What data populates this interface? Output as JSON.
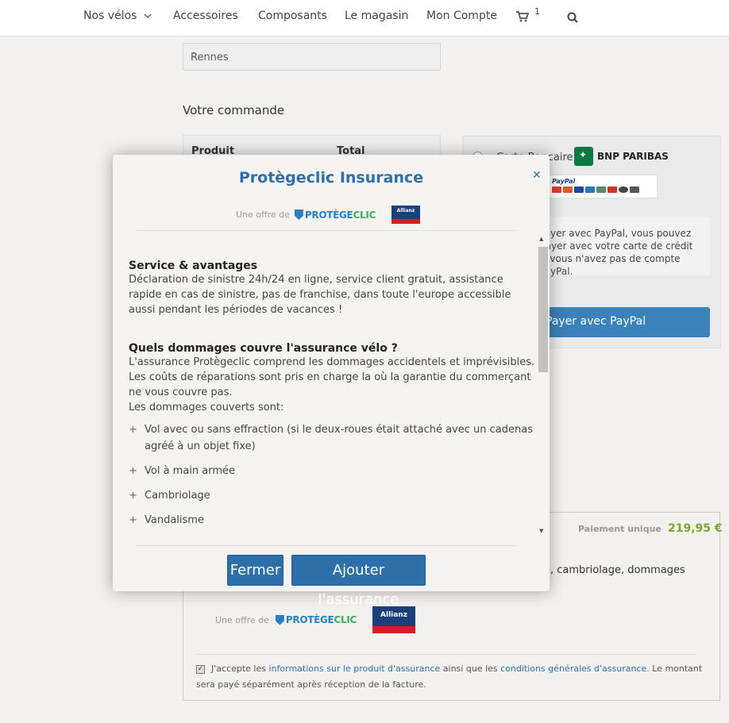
{
  "nav": {
    "items": [
      "Nos vélos",
      "Accessoires",
      "Composants",
      "Le magasin",
      "Mon Compte"
    ],
    "cart_count": "1"
  },
  "page": {
    "city_value": "Rennes",
    "order_title": "Votre commande",
    "order_headers": [
      "Produit",
      "Total"
    ],
    "payment": {
      "card_label": "Carte Bancaire",
      "bank_logo": "BNP PARIBAS",
      "paypal_wordmark": "PayPal",
      "paypal_info": "Payer avec PayPal, vous pouvez payer avec votre carte de crédit si vous n'avez pas de compte PayPal.",
      "paypal_button": "Payer avec PayPal"
    },
    "insurance": {
      "price_label": "Paiement unique",
      "price_value": "219,95 €",
      "description_partial": "ée, cambriolage, dommages",
      "offer_label": "Une offre de",
      "accept_prefix": "J'accepte les ",
      "accept_link1": "informations sur le produit d'assurance",
      "accept_middle": " ainsi que les ",
      "accept_link2": "conditions générales d'assurance",
      "accept_suffix": ". Le montant sera payé séparément après réception de la facture."
    }
  },
  "brand": {
    "protegeclic_a": "PROTÈGE",
    "protegeclic_b": "CLIC",
    "allianz": "Allianz"
  },
  "modal": {
    "title": "Protègeclic Insurance",
    "offer_label": "Une offre de",
    "section1_title": "Service & avantages",
    "section1_text": "Déclaration de sinistre 24h/24 en ligne, service client gratuit, assistance rapide en cas de sinistre, pas de franchise, dans toute l'europe accessible aussi pendant les périodes de vacances !",
    "section2_title": "Quels dommages couvre l'assurance vélo ?",
    "section2_text1": "L'assurance Protègeclic comprend les dommages accidentels et imprévisibles.",
    "section2_text2": "Les coûts de réparations sont pris en charge la où la garantie du commerçant ne vous couvre pas.",
    "section2_text3": "Les dommages couverts sont:",
    "covered": [
      "Vol avec ou sans effraction (si le deux-roues était attaché avec un cadenas agréé à un objet fixe)",
      "Vol à main armée",
      "Cambriolage",
      "Vandalisme"
    ],
    "close_button": "Fermer",
    "add_button": "Ajouter l'assurance"
  },
  "colors": {
    "accent": "#2d6fa8",
    "price_green": "#7aa52b",
    "brand_green": "#3bb15e",
    "allianz_blue": "#1b3f7a"
  },
  "icons": [
    "chevron-down-icon",
    "cart-icon",
    "search-icon",
    "close-icon"
  ]
}
